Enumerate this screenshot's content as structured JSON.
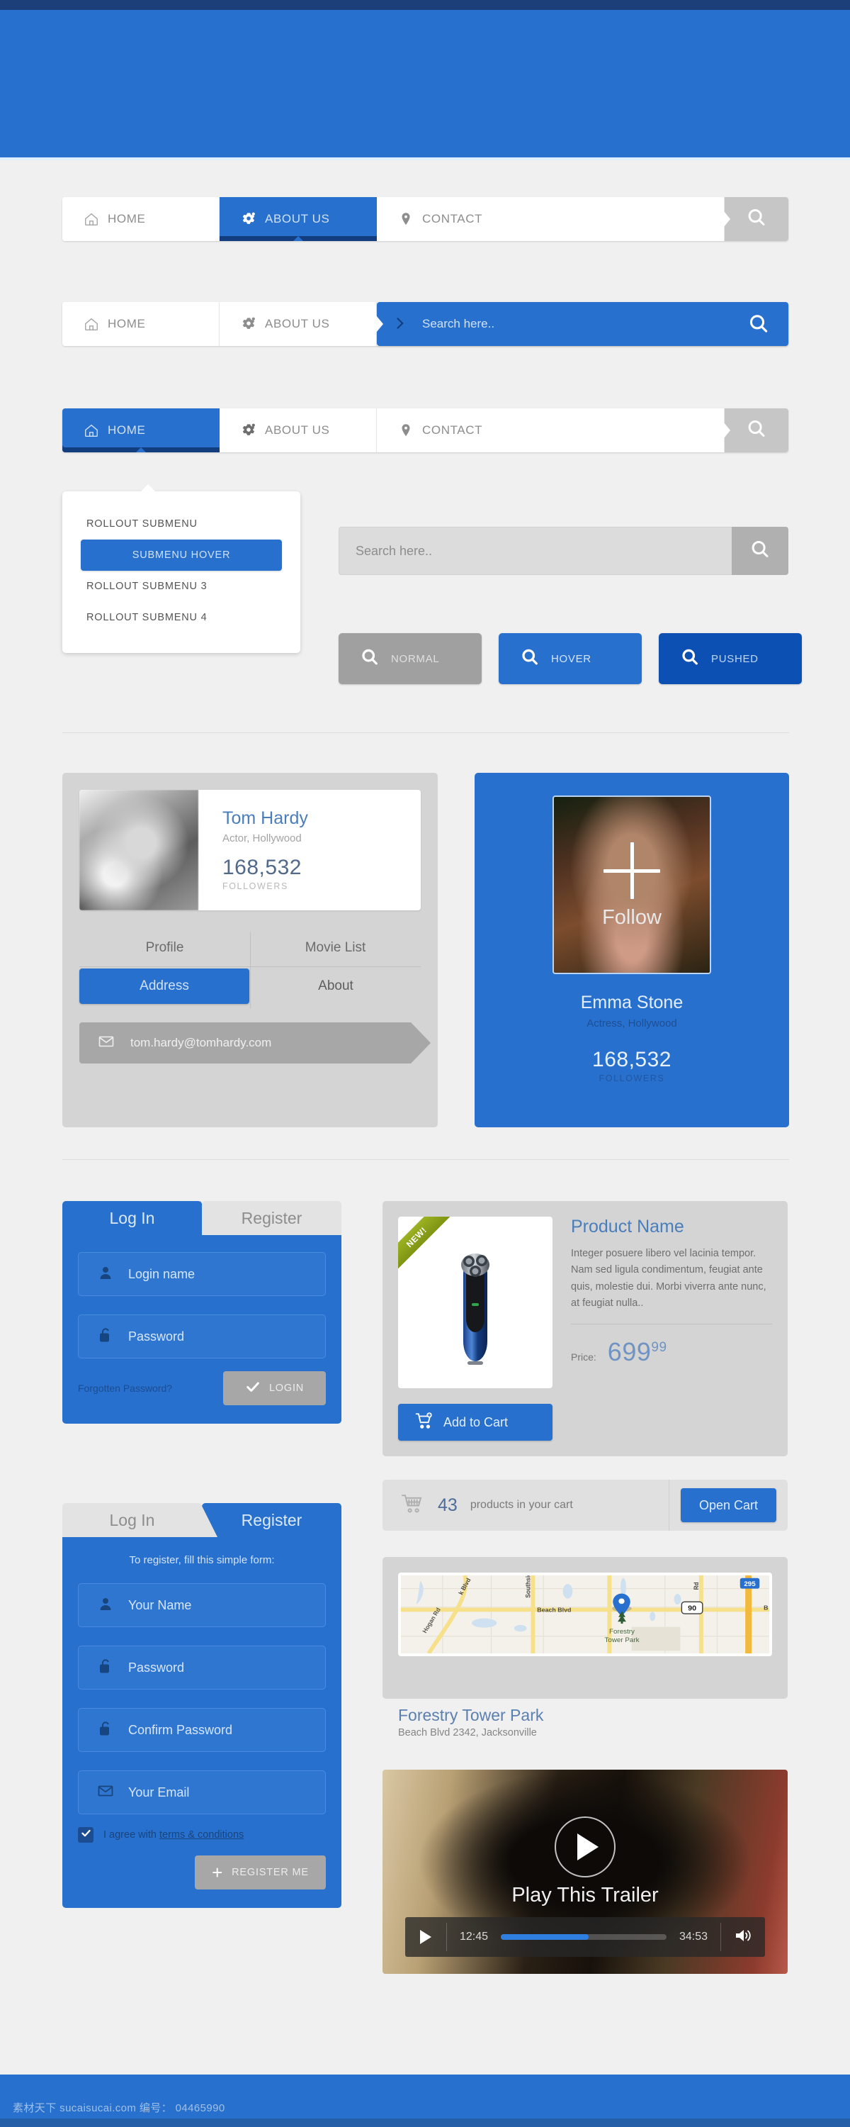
{
  "hero": {
    "label": ""
  },
  "nav_bars": [
    {
      "items": [
        {
          "label": "HOME",
          "icon": "home-icon",
          "state": "normal"
        },
        {
          "label": "ABOUT US",
          "icon": "gear-icon",
          "state": "active"
        },
        {
          "label": "CONTACT",
          "icon": "pin-icon",
          "state": "normal"
        }
      ],
      "search_icon": "search-icon"
    },
    {
      "items": [
        {
          "label": "HOME",
          "icon": "home-icon",
          "state": "normal"
        },
        {
          "label": "ABOUT US",
          "icon": "gear-icon",
          "state": "normal"
        }
      ],
      "search_open_placeholder": "Search here..",
      "arrow_icon": "chevron-right-icon",
      "search_icon": "search-icon"
    },
    {
      "items": [
        {
          "label": "HOME",
          "icon": "home-icon",
          "state": "active"
        },
        {
          "label": "ABOUT US",
          "icon": "gear-icon",
          "state": "normal"
        },
        {
          "label": "CONTACT",
          "icon": "pin-icon",
          "state": "normal"
        }
      ],
      "search_icon": "search-icon"
    }
  ],
  "dropdown": {
    "items": [
      {
        "label": "ROLLOUT SUBMENU",
        "state": "normal"
      },
      {
        "label": "SUBMENU HOVER",
        "state": "hover"
      },
      {
        "label": "ROLLOUT SUBMENU 3",
        "state": "normal"
      },
      {
        "label": "ROLLOUT SUBMENU 4",
        "state": "normal"
      }
    ]
  },
  "search_field": {
    "placeholder": "Search here..",
    "icon": "search-icon"
  },
  "state_buttons": [
    {
      "label": "NORMAL",
      "state": "normal",
      "color": "#a0a0a0",
      "icon": "search-icon"
    },
    {
      "label": "HOVER",
      "state": "hover",
      "color": "#2870cd",
      "icon": "search-icon"
    },
    {
      "label": "PUSHED",
      "state": "pushed",
      "color": "#0c50b4",
      "icon": "search-icon"
    }
  ],
  "profile_card": {
    "name": "Tom Hardy",
    "role": "Actor, Hollywood",
    "followers_count": "168,532",
    "followers_label": "FOLLOWERS",
    "tabs_row1": [
      "Profile",
      "Movie List"
    ],
    "tabs_row2": [
      {
        "label": "Address",
        "active": true
      },
      {
        "label": "About",
        "active": false
      }
    ],
    "email": "tom.hardy@tomhardy.com",
    "email_icon": "envelope-icon"
  },
  "follow_card": {
    "name": "Emma Stone",
    "role": "Actress, Hollywood",
    "followers_count": "168,532",
    "followers_label": "FOLLOWERS",
    "follow_label": "Follow",
    "plus_icon": "plus-icon"
  },
  "login_form": {
    "tabs": [
      {
        "label": "Log In",
        "active": true
      },
      {
        "label": "Register",
        "active": false
      }
    ],
    "fields": [
      {
        "placeholder": "Login name",
        "icon": "user-icon"
      },
      {
        "placeholder": "Password",
        "icon": "lock-icon"
      }
    ],
    "forgot_label": "Forgotten Password?",
    "submit_label": "LOGIN",
    "submit_icon": "check-icon"
  },
  "register_form": {
    "tabs": [
      {
        "label": "Log In",
        "active": false
      },
      {
        "label": "Register",
        "active": true
      }
    ],
    "note": "To register, fill this simple form:",
    "fields": [
      {
        "placeholder": "Your Name",
        "icon": "user-icon"
      },
      {
        "placeholder": "Password",
        "icon": "lock-icon"
      },
      {
        "placeholder": "Confirm Password",
        "icon": "lock-icon"
      },
      {
        "placeholder": "Your Email",
        "icon": "envelope-icon"
      }
    ],
    "agree_prefix": "I agree with ",
    "agree_link": "terms & conditions",
    "agree_checked": true,
    "submit_label": "REGISTER ME",
    "submit_icon": "plus-icon"
  },
  "product_card": {
    "ribbon": "NEW!",
    "name": "Product Name",
    "description": "Integer posuere libero vel lacinia tempor. Nam sed ligula condimentum, feugiat ante quis, molestie dui. Morbi viverra ante nunc, at feugiat nulla..",
    "price_label": "Price:",
    "price_main": "699",
    "price_cents": "99",
    "cart_button": "Add to Cart",
    "cart_icon": "cart-add-icon"
  },
  "cart_bar": {
    "count": "43",
    "text": "products in your cart",
    "button": "Open Cart",
    "icon": "cart-icon"
  },
  "map_card": {
    "title": "Forestry Tower Park",
    "address": "Beach Blvd 2342, Jacksonville",
    "labels": {
      "beach_blvd": "Beach Blvd",
      "hogan_rd": "Hogan Rd",
      "southside": "Southsid",
      "k_blvd": "k Blvd",
      "rd": "Rd",
      "park_name": "Forestry Tower Park",
      "hwy90": "90",
      "hwy295": "295"
    },
    "pin_icon": "map-pin-icon"
  },
  "video_card": {
    "title": "Play This Trailer",
    "current_time": "12:45",
    "duration": "34:53",
    "progress_percent": 53,
    "play_icon": "play-icon",
    "volume_icon": "volume-icon"
  },
  "watermark": "素材天下 sucaisucai.com  编号： 04465990",
  "colors": {
    "brand_blue": "#2870cd",
    "dark_blue": "#0c50b4",
    "grey": "#a0a0a0",
    "panel_bg": "#f0f0f0"
  }
}
